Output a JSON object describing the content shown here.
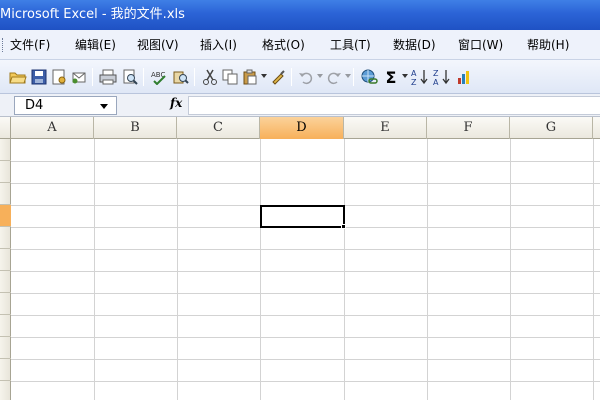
{
  "window": {
    "title": "Microsoft Excel - 我的文件.xls"
  },
  "menu": {
    "items": [
      {
        "label": "文件(F)"
      },
      {
        "label": "编辑(E)"
      },
      {
        "label": "视图(V)"
      },
      {
        "label": "插入(I)"
      },
      {
        "label": "格式(O)"
      },
      {
        "label": "工具(T)"
      },
      {
        "label": "数据(D)"
      },
      {
        "label": "窗口(W)"
      },
      {
        "label": "帮助(H)"
      }
    ]
  },
  "toolbar": {
    "icons": [
      "new-icon",
      "open-icon",
      "save-icon",
      "permission-icon",
      "email-icon",
      "print-icon",
      "print-preview-icon",
      "spelling-icon",
      "research-icon",
      "cut-icon",
      "copy-icon",
      "paste-icon",
      "format-painter-icon",
      "undo-icon",
      "redo-icon",
      "hyperlink-icon",
      "autosum-icon",
      "sort-ascending-icon",
      "sort-descending-icon",
      "chart-icon"
    ],
    "autosum_symbol": "Σ"
  },
  "formula_bar": {
    "name_box": "D4",
    "fx_label": "fx",
    "formula": ""
  },
  "sheet": {
    "columns": [
      "A",
      "B",
      "C",
      "D",
      "E",
      "F",
      "G"
    ],
    "active_column": "D",
    "active_row": 4,
    "selected_cell": "D4"
  },
  "colors": {
    "title_bar": "#2b63d6",
    "active_header": "#f7b05a",
    "grid_line": "#d3d3d3"
  }
}
